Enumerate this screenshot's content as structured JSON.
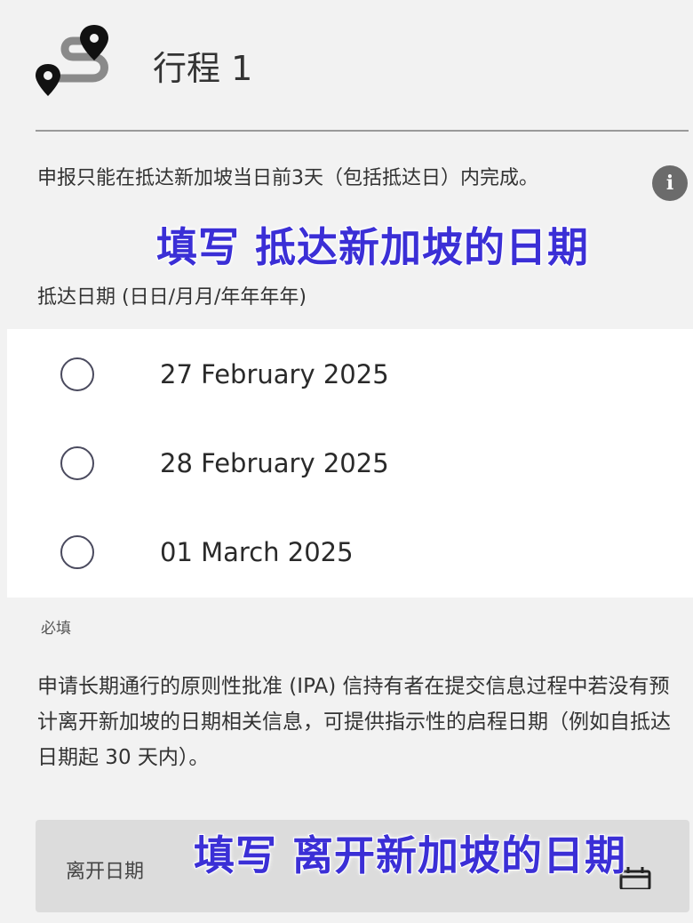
{
  "header": {
    "title": "行程 1",
    "icon": "route-pins-icon"
  },
  "notice": {
    "text": "申报只能在抵达新加坡当日前3天（包括抵达日）内完成。",
    "info_icon_glyph": "i"
  },
  "overlays": {
    "arrival": "填写 抵达新加坡的日期",
    "departure": "填写 离开新加坡的日期"
  },
  "arrival": {
    "label": "抵达日期 (日日/月月/年年年年)",
    "options": [
      {
        "label": "27 February 2025",
        "selected": false
      },
      {
        "label": "28 February 2025",
        "selected": false
      },
      {
        "label": "01 March 2025",
        "selected": false
      }
    ]
  },
  "required_label": "必填",
  "ipa_note": "申请长期通行的原则性批准 (IPA) 信持有者在提交信息过程中若没有预计离开新加坡的日期相关信息，可提供指示性的启程日期（例如自抵达日期起 30 天内）。",
  "departure": {
    "label": "离开日期",
    "icon": "calendar-icon"
  },
  "colors": {
    "overlay_text": "#3b2fd6",
    "background": "#f2f2f2",
    "option_bg": "#ffffff",
    "field_bg": "#dcdcdc"
  }
}
